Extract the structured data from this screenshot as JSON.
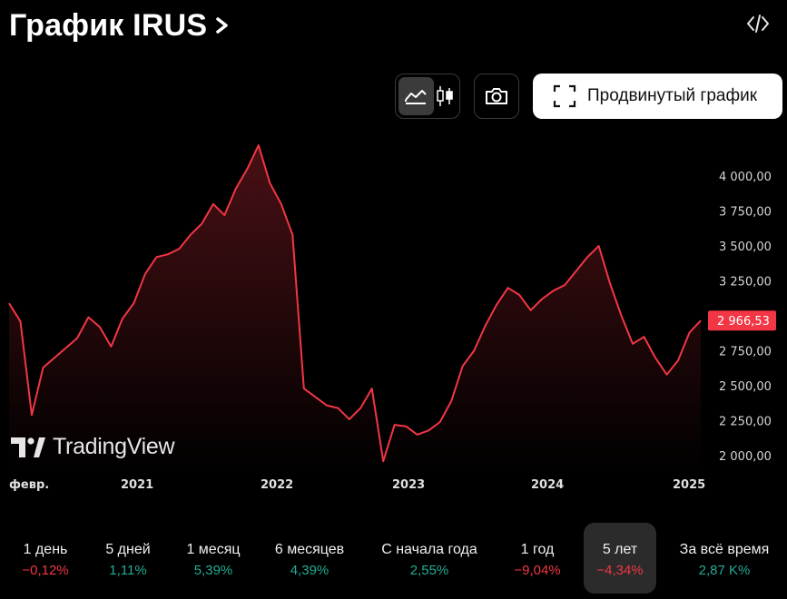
{
  "header": {
    "title": "График IRUS"
  },
  "toolbar": {
    "advanced_label": "Продвинутый график"
  },
  "icons": {
    "title": "chevron-right-icon",
    "embed": "code-icon",
    "area": "area-chart-icon",
    "candles": "candles-icon",
    "camera": "camera-icon",
    "advanced": "fullscreen-icon",
    "watermark": "tradingview-logo"
  },
  "colors": {
    "line": "#f23645",
    "negative": "#f23645",
    "positive": "#22ab94",
    "background": "#000000"
  },
  "watermark": "TradingView",
  "chart_data": {
    "type": "area",
    "y_ticks": [
      "4 000,00",
      "3 750,00",
      "3 500,00",
      "3 250,00",
      "3 000,00",
      "2 750,00",
      "2 500,00",
      "2 250,00",
      "2 000,00"
    ],
    "x_labels": [
      "февр.",
      "2021",
      "2022",
      "2023",
      "2024",
      "2025"
    ],
    "last_value": "2 966,53",
    "ylim": [
      1950,
      4250
    ],
    "x_range": [
      "2020-02",
      "2025-02"
    ],
    "series": [
      {
        "x": [
          "2020-02",
          "2020-03",
          "2020-03",
          "2020-04",
          "2020-05",
          "2020-06",
          "2020-07",
          "2020-08",
          "2020-09",
          "2020-10",
          "2020-11",
          "2020-12",
          "2021-01",
          "2021-02",
          "2021-03",
          "2021-04",
          "2021-05",
          "2021-06",
          "2021-07",
          "2021-08",
          "2021-09",
          "2021-10",
          "2021-11",
          "2021-12",
          "2022-01",
          "2022-02",
          "2022-03",
          "2022-04",
          "2022-05",
          "2022-06",
          "2022-07",
          "2022-08",
          "2022-09",
          "2022-10",
          "2022-11",
          "2022-12",
          "2023-01",
          "2023-02",
          "2023-03",
          "2023-04",
          "2023-05",
          "2023-06",
          "2023-07",
          "2023-08",
          "2023-09",
          "2023-10",
          "2023-11",
          "2023-12",
          "2024-01",
          "2024-02",
          "2024-03",
          "2024-04",
          "2024-05",
          "2024-06",
          "2024-07",
          "2024-08",
          "2024-09",
          "2024-10",
          "2024-11",
          "2024-12",
          "2025-01",
          "2025-02"
        ],
        "y": [
          3090,
          2960,
          2290,
          2630,
          2700,
          2770,
          2840,
          2990,
          2920,
          2780,
          2980,
          3090,
          3300,
          3420,
          3440,
          3480,
          3580,
          3660,
          3800,
          3720,
          3910,
          4050,
          4220,
          3950,
          3800,
          3580,
          2480,
          2420,
          2360,
          2340,
          2260,
          2340,
          2480,
          1960,
          2220,
          2210,
          2150,
          2180,
          2240,
          2390,
          2640,
          2750,
          2930,
          3080,
          3200,
          3150,
          3040,
          3120,
          3180,
          3220,
          3320,
          3420,
          3500,
          3230,
          3000,
          2800,
          2850,
          2700,
          2580,
          2680,
          2880,
          2966.53
        ]
      }
    ]
  },
  "periods": [
    {
      "label": "1 день",
      "value": "−0,12%",
      "sign": "neg"
    },
    {
      "label": "5 дней",
      "value": "1,11%",
      "sign": "pos"
    },
    {
      "label": "1 месяц",
      "value": "5,39%",
      "sign": "pos"
    },
    {
      "label": "6 месяцев",
      "value": "4,39%",
      "sign": "pos"
    },
    {
      "label": "С начала года",
      "value": "2,55%",
      "sign": "pos"
    },
    {
      "label": "1 год",
      "value": "−9,04%",
      "sign": "neg"
    },
    {
      "label": "5 лет",
      "value": "−4,34%",
      "sign": "neg",
      "active": true
    },
    {
      "label": "За всё время",
      "value": "2,87 K%",
      "sign": "pos"
    }
  ]
}
